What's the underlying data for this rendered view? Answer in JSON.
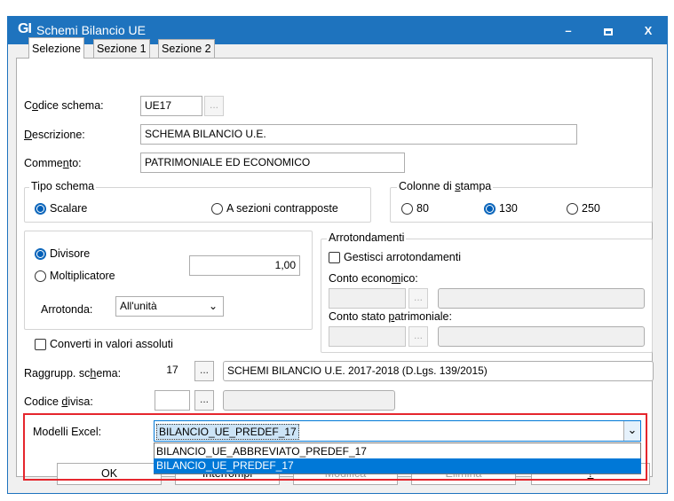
{
  "window": {
    "logo": "GI",
    "title": "Schemi Bilancio UE",
    "controls": {
      "minimize": "–",
      "maximize": "▬",
      "close": "X"
    }
  },
  "tabs": [
    "Selezione",
    "Sezione 1",
    "Sezione 2"
  ],
  "form": {
    "codice_schema": {
      "label_pre": "C",
      "label_u": "o",
      "label_post": "dice schema:",
      "value": "UE17",
      "dots": "..."
    },
    "descrizione": {
      "label_u": "D",
      "label_post": "escrizione:",
      "value": "SCHEMA BILANCIO U.E."
    },
    "commento": {
      "label_pre": "Comme",
      "label_u": "n",
      "label_post": "to:",
      "value": "PATRIMONIALE ED ECONOMICO"
    },
    "tipo_schema": {
      "title": "Tipo schema",
      "options": [
        "Scalare",
        "A sezioni contrapposte"
      ],
      "selected": "Scalare"
    },
    "colonne_stampa": {
      "title_pre": "Colonne di ",
      "title_u": "s",
      "title_post": "tampa",
      "options": [
        "80",
        "130",
        "250"
      ],
      "selected": "130"
    },
    "divisore": "Divisore",
    "moltiplicatore": "Moltiplicatore",
    "divisore_selected": true,
    "fattore_value": "1,00",
    "arrotonda": {
      "label": "Arrotonda:",
      "value": "All'unità"
    },
    "arrotondamenti": {
      "title": "Arrotondamenti",
      "gestisci": "Gestisci arrotondamenti",
      "conto_economico": {
        "label_pre": "Conto econo",
        "label_u": "m",
        "label_post": "ico:"
      },
      "conto_stato": {
        "label_pre": "Conto stato ",
        "label_u": "p",
        "label_post": "atrimoniale:"
      },
      "dots": "..."
    },
    "converti": "Converti in valori assoluti",
    "raggrupp": {
      "label_pre": "Raggrupp. sc",
      "label_u": "h",
      "label_post": "ema:",
      "code": "17",
      "dots": "...",
      "desc": "SCHEMI BILANCIO U.E. 2017-2018 (D.Lgs. 139/2015)"
    },
    "codice_divisa": {
      "label_pre": "Codice ",
      "label_u": "d",
      "label_post": "ivisa:",
      "dots": "..."
    },
    "modelli_excel": {
      "label": "Modelli Excel:",
      "value": "BILANCIO_UE_PREDEF_17",
      "options": [
        "BILANCIO_UE_ABBREVIATO_PREDEF_17",
        "BILANCIO_UE_PREDEF_17"
      ],
      "highlighted": "BILANCIO_UE_PREDEF_17"
    }
  },
  "buttons": [
    "OK",
    "Interrompi",
    "Modifica",
    "Elimina",
    "?"
  ],
  "colors": {
    "titlebar": "#1e73be",
    "highlight": "#0078d7",
    "annotation": "#e5262d"
  }
}
